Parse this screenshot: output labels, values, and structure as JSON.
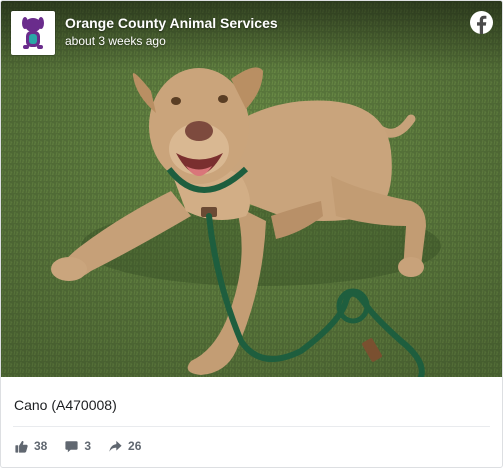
{
  "post": {
    "page_name": "Orange County Animal Services",
    "timestamp": "about 3 weeks ago",
    "caption": "Cano (A470008)"
  },
  "icons": {
    "avatar": "dog-logo",
    "platform": "facebook-icon",
    "like": "thumbs-up-icon",
    "comment": "comment-bubble-icon",
    "share": "share-arrow-icon"
  },
  "stats": {
    "likes": "38",
    "comments": "3",
    "shares": "26"
  },
  "colors": {
    "avatar_logo": "#6a2c8c",
    "icon_gray": "#606770",
    "leash": "#1e5e3e"
  }
}
